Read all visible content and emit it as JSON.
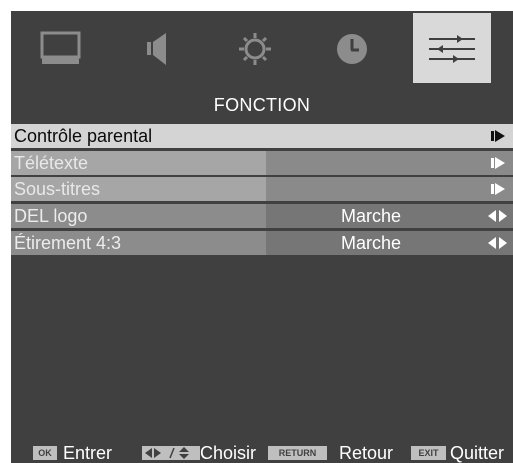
{
  "tabs": [
    {
      "icon": "picture-icon",
      "active": false
    },
    {
      "icon": "speaker-icon",
      "active": false
    },
    {
      "icon": "gear-icon",
      "active": false
    },
    {
      "icon": "clock-icon",
      "active": false
    },
    {
      "icon": "sliders-icon",
      "active": true
    }
  ],
  "section_title": "FONCTION",
  "menu": [
    {
      "label": "Contrôle parental",
      "value": "",
      "arrow": "right-arrow-icon",
      "selected": true
    },
    {
      "label": "Télétexte",
      "value": "",
      "arrow": "right-arrow-icon"
    },
    {
      "label": "Sous-titres",
      "value": "",
      "arrow": "right-arrow-icon"
    },
    {
      "label": "DEL logo",
      "value": "Marche",
      "arrow": "left-right-arrow-icon"
    },
    {
      "label": "Étirement 4:3",
      "value": "Marche",
      "arrow": "left-right-arrow-icon"
    }
  ],
  "help": {
    "ok_key": "OK",
    "ok_text": "Entrer",
    "choose_text": "Choisir",
    "return_key": "RETURN",
    "return_text": "Retour",
    "exit_key": "EXIT",
    "exit_text": "Quitter"
  },
  "colors": {
    "background": "#404040",
    "selected_row": "#d4d4d4",
    "active_tab": "#d9d9d9",
    "text": "#ffffff"
  }
}
